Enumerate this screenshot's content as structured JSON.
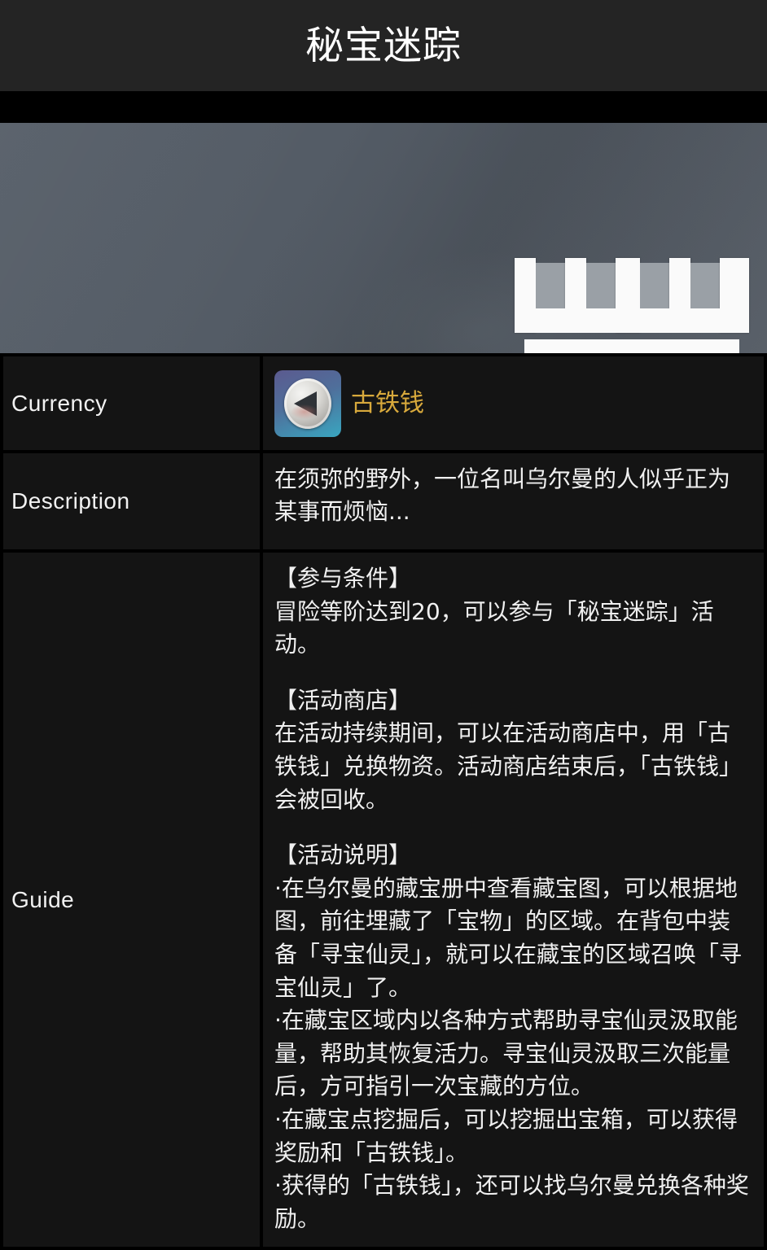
{
  "header": {
    "title": "秘宝迷踪"
  },
  "banner": {
    "icon_name": "treasure-chest-icon",
    "background_color": "#525a63"
  },
  "table": {
    "rows": [
      {
        "label": "Currency"
      },
      {
        "label": "Description"
      },
      {
        "label": "Guide"
      }
    ]
  },
  "currency": {
    "label": "Currency",
    "item_name": "古铁钱",
    "item_name_color": "#d8a93c",
    "icon_name": "ancient-iron-coin-icon"
  },
  "description": {
    "label": "Description",
    "text": "在须弥的野外，一位名叫乌尔曼的人似乎正为某事而烦恼..."
  },
  "guide": {
    "label": "Guide",
    "section_1_heading": "【参与条件】",
    "section_1_body": "冒险等阶达到20，可以参与「秘宝迷踪」活动。",
    "section_2_heading": "【活动商店】",
    "section_2_body": "在活动持续期间，可以在活动商店中，用「古铁钱」兑换物资。活动商店结束后，「古铁钱」会被回收。",
    "section_3_heading": "【活动说明】",
    "section_3_body": "·在乌尔曼的藏宝册中查看藏宝图，可以根据地图，前往埋藏了「宝物」的区域。在背包中装备「寻宝仙灵」，就可以在藏宝的区域召唤「寻宝仙灵」了。\n·在藏宝区域内以各种方式帮助寻宝仙灵汲取能量，帮助其恢复活力。寻宝仙灵汲取三次能量后，方可指引一次宝藏的方位。\n·在藏宝点挖掘后，可以挖掘出宝箱，可以获得奖励和「古铁钱」。\n·获得的「古铁钱」，还可以找乌尔曼兑换各种奖励。"
  }
}
